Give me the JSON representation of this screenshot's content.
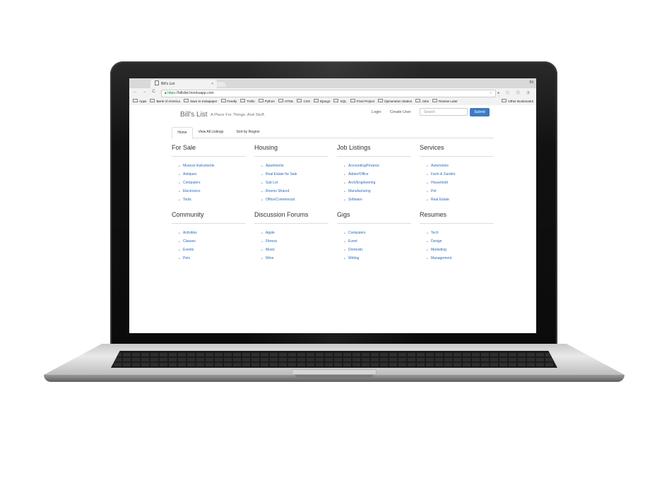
{
  "browser": {
    "tab_title": "Bill's List",
    "tab_close": "×",
    "user_label": "Bil",
    "nav_icons": "← → C ⌂",
    "url_scheme": "https://",
    "url_host": "billslist.herokuapp.com",
    "star": "☆",
    "ext_icons": "● ⓘ ◎ ▣ ⋮",
    "bookmarks": [
      {
        "label": "Apps"
      },
      {
        "label": "Bank of America"
      },
      {
        "label": "Save to Instapaper"
      },
      {
        "label": "Feedly"
      },
      {
        "label": "Trello"
      },
      {
        "label": "Python"
      },
      {
        "label": "HTML"
      },
      {
        "label": "CSS"
      },
      {
        "label": "Django"
      },
      {
        "label": "SQL"
      },
      {
        "label": "Final Project"
      },
      {
        "label": "Djeneration Station"
      },
      {
        "label": "Jobs"
      },
      {
        "label": "Review Later"
      }
    ],
    "other_bookmarks": "Other Bookmarks"
  },
  "site": {
    "brand": "Bill's List",
    "tagline": "A Place For Things. And Stuff.",
    "nav": {
      "login": "Login",
      "create_user": "Create User"
    },
    "search_placeholder": "Search",
    "submit_label": "Submit",
    "tabs": [
      "Home",
      "View All Listings",
      "Sort by Region"
    ]
  },
  "categories": [
    {
      "title": "For Sale",
      "items": [
        "Musical Instruments",
        "Antiques",
        "Computers",
        "Electronics",
        "Tools"
      ]
    },
    {
      "title": "Housing",
      "items": [
        "Apartments",
        "Real Estate for Sale",
        "Sub Let",
        "Rooms Shared",
        "Office/Commercial"
      ]
    },
    {
      "title": "Job Listings",
      "items": [
        "Accounting/Finance",
        "Admin/Office",
        "Arch/Engineering",
        "Manufacturing",
        "Software"
      ]
    },
    {
      "title": "Services",
      "items": [
        "Automotive",
        "Farm & Garden",
        "Household",
        "Pet",
        "Real Estate"
      ]
    },
    {
      "title": "Community",
      "items": [
        "Activities",
        "Classes",
        "Events",
        "Pets"
      ]
    },
    {
      "title": "Discussion Forums",
      "items": [
        "Apple",
        "Fitness",
        "Music",
        "Wine"
      ]
    },
    {
      "title": "Gigs",
      "items": [
        "Computers",
        "Event",
        "Domestic",
        "Writing"
      ]
    },
    {
      "title": "Resumes",
      "items": [
        "Tech",
        "Design",
        "Marketing",
        "Management"
      ]
    }
  ]
}
